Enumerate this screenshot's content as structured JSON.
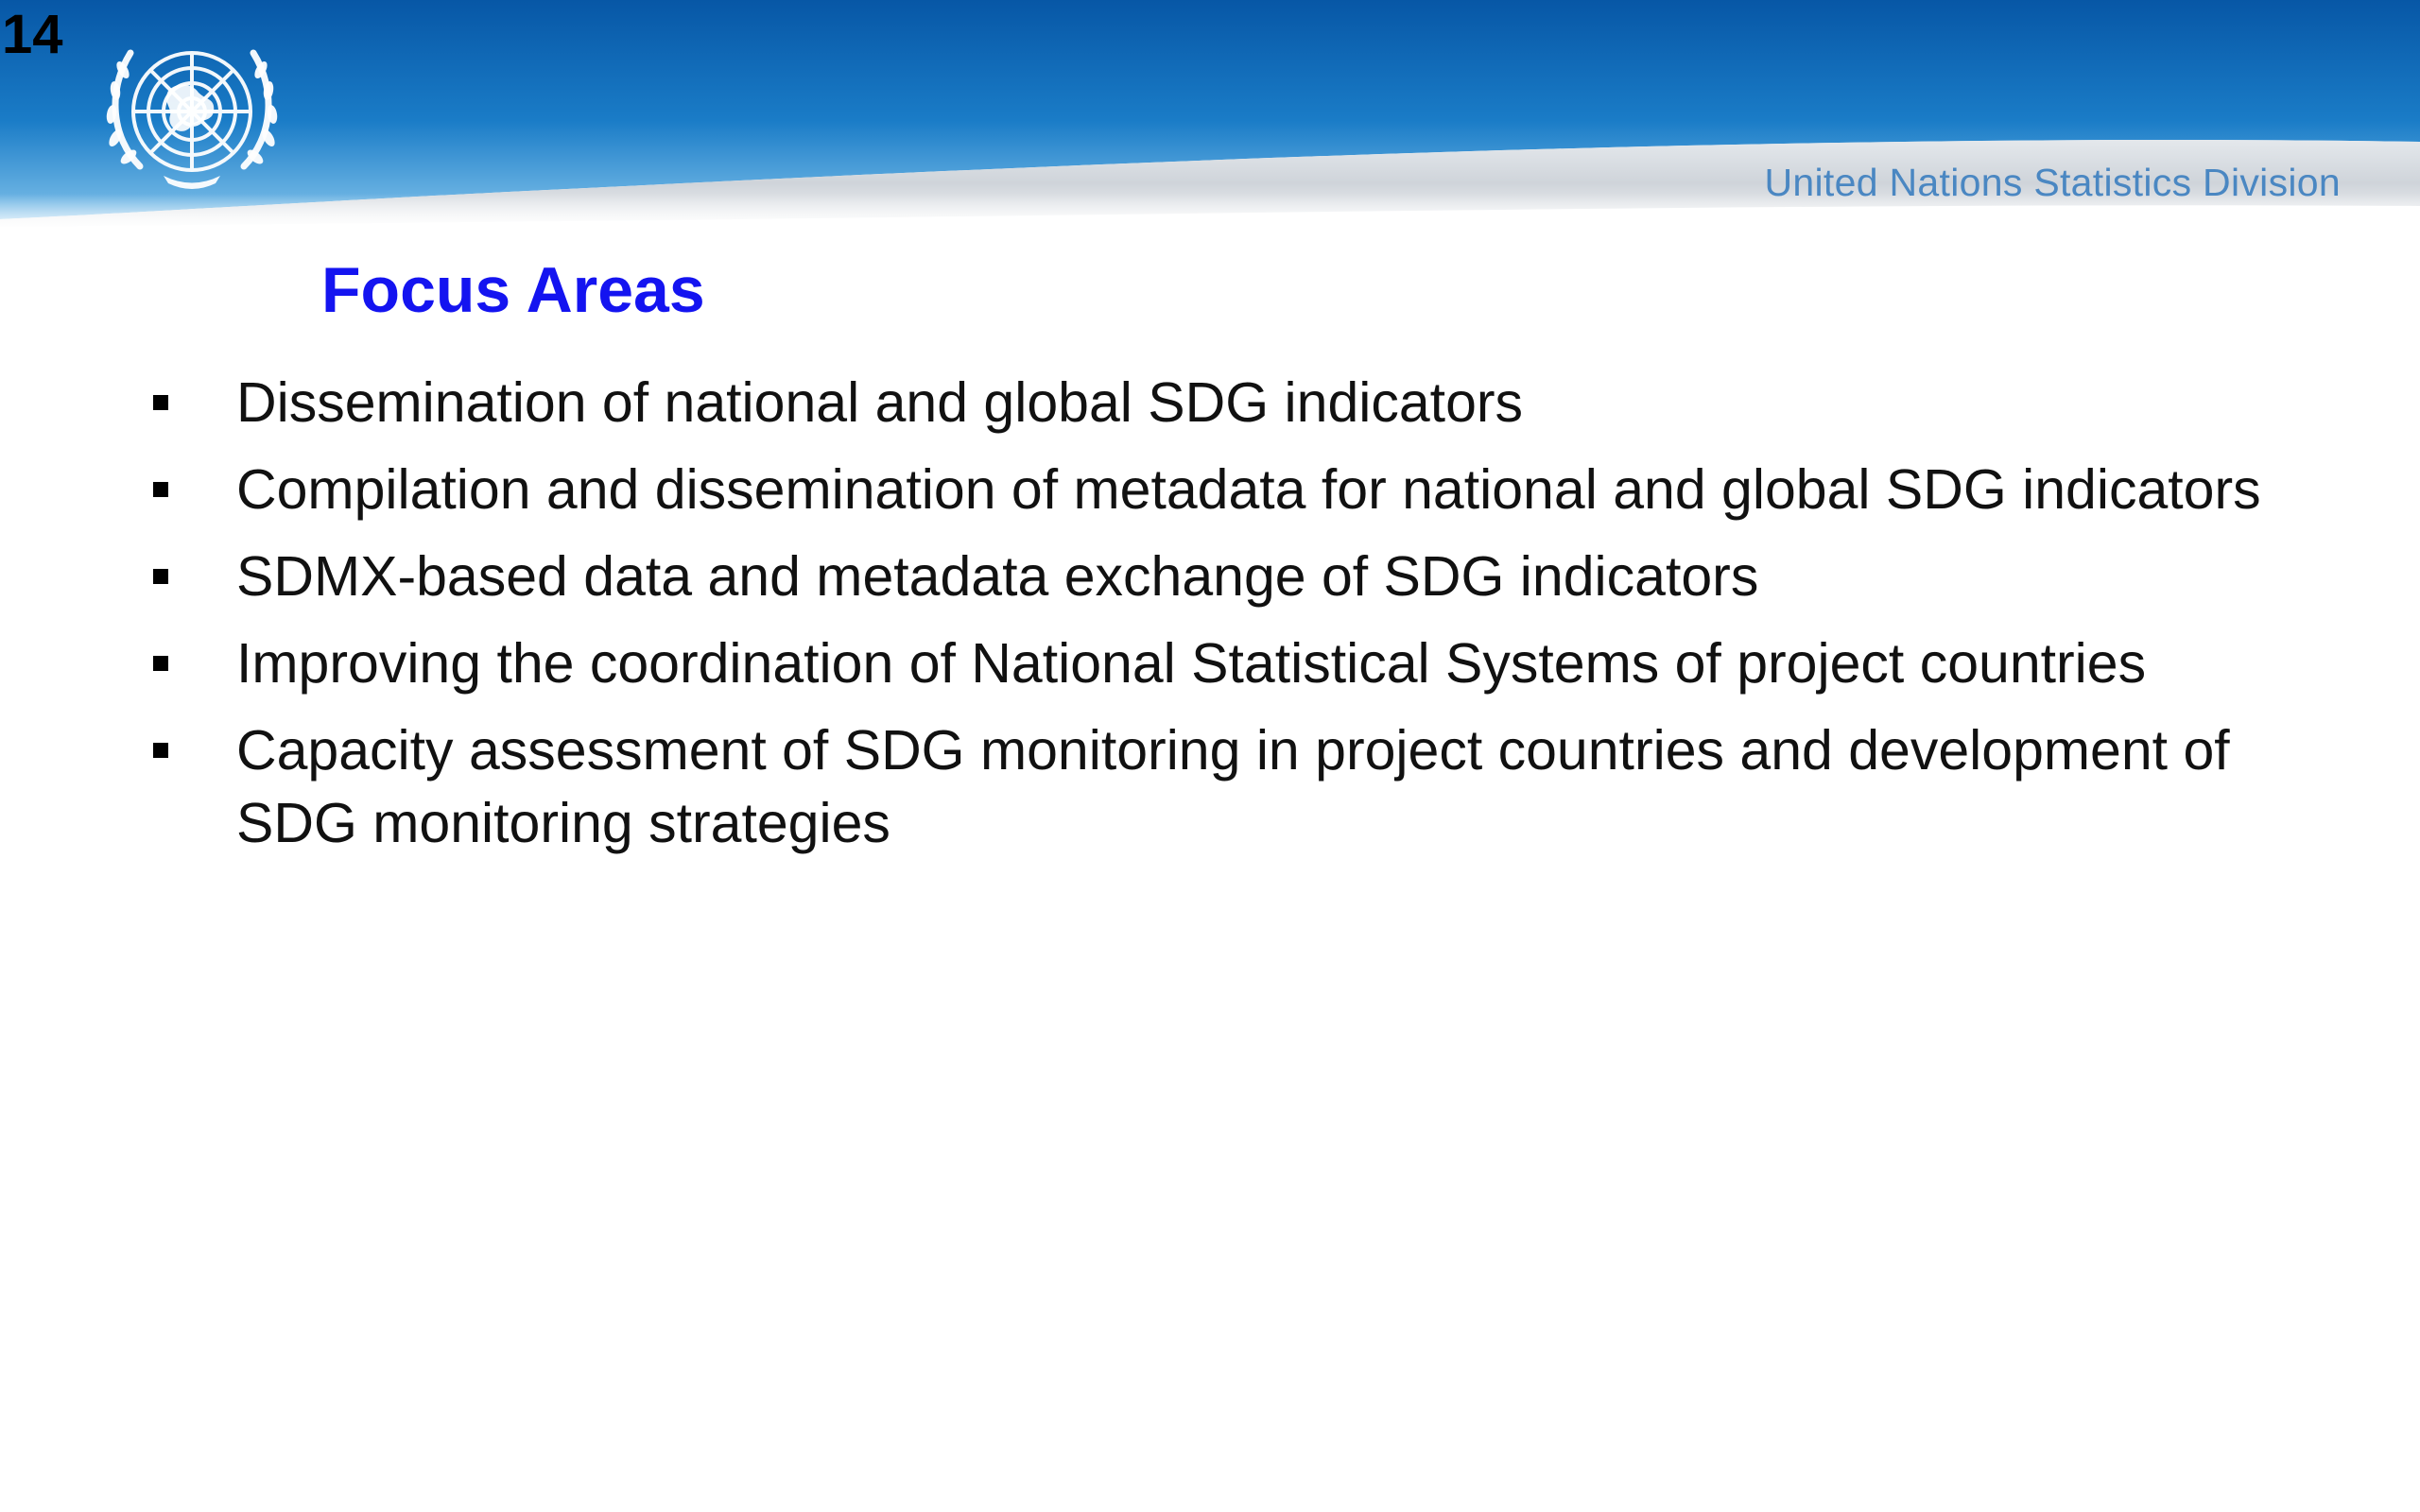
{
  "slide": {
    "number": "14",
    "organization": "United Nations Statistics Division",
    "logo_icon": "un-emblem-icon",
    "header_colors": {
      "blue_dark": "#0b5aa8",
      "blue_light": "#3a97d6",
      "silver": "#c8cdd3"
    }
  },
  "content": {
    "title": "Focus Areas",
    "title_color": "#1414f0",
    "bullets": [
      {
        "text": "Dissemination of national and global SDG indicators"
      },
      {
        "text": "Compilation and dissemination of metadata for national and global SDG indicators"
      },
      {
        "text": "SDMX-based data and metadata exchange of SDG indicators"
      },
      {
        "text": "Improving the coordination of National Statistical Systems of project countries"
      },
      {
        "text": "Capacity assessment of SDG monitoring in project countries and development of SDG monitoring strategies"
      }
    ]
  }
}
